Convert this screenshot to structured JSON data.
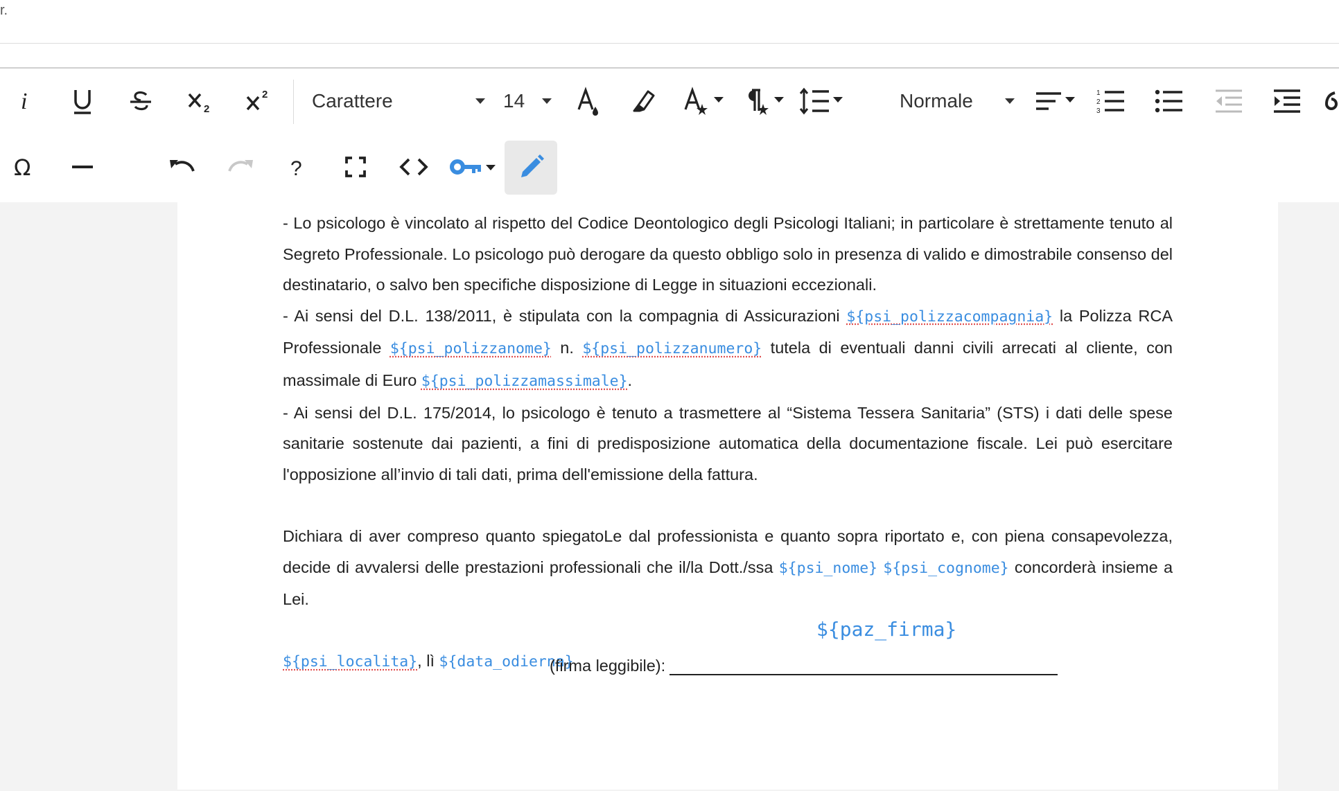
{
  "toolbar": {
    "row1": {
      "font_select": "Carattere",
      "size_select": "14",
      "style_select": "Normale"
    }
  },
  "document": {
    "paragraphs": [
      [
        {
          "t": "- Lo psicologo è vincolato al rispetto del Codice Deontologico degli Psicologi Italiani; in particolare è strettamente tenuto al Segreto Professionale. Lo psicologo può derogare da questo obbligo solo in presenza di valido e dimostrabile consenso del destinatario, o salvo ben specifiche disposizione di Legge in situazioni eccezionali."
        }
      ],
      [
        {
          "t": "- Ai sensi del D.L. 138/2011, è stipulata con la compagnia di Assicurazioni "
        },
        {
          "v": "${psi_polizzacompagnia}"
        },
        {
          "t": " la Polizza RCA Professionale "
        },
        {
          "v": "${psi_polizzanome}"
        },
        {
          "t": " n. "
        },
        {
          "v": "${psi_polizzanumero}"
        },
        {
          "t": " tutela di eventuali danni civili arrecati al cliente, con massimale di Euro "
        },
        {
          "v": "${psi_polizzamassimale}"
        },
        {
          "t": "."
        }
      ],
      [
        {
          "t": "- Ai sensi del D.L. 175/2014, lo psicologo è tenuto a trasmettere al “Sistema Tessera Sanitaria” (STS) i dati delle spese sanitarie sostenute dai pazienti, a fini di predisposizione automatica della documentazione fiscale. Lei può esercitare l'opposizione all’invio di tali dati, prima dell'emissione della fattura."
        }
      ],
      [],
      [
        {
          "t": "Dichiara di aver compreso quanto spiegatoLe dal professionista e quanto sopra riportato e, con piena consapevolezza, decide di avvalersi delle prestazioni professionali che il/la Dott./ssa "
        },
        {
          "v": "${psi_nome}"
        },
        {
          "t": " "
        },
        {
          "v": "${psi_cognome}"
        },
        {
          "t": " concorderà insieme a Lei."
        }
      ],
      [],
      [
        {
          "v": "${psi_localita}"
        },
        {
          "t": ", lì "
        },
        {
          "v": "${data_odierna}"
        }
      ]
    ],
    "signature_var": "${paz_firma}",
    "signature_label": "(firma leggibile):"
  }
}
